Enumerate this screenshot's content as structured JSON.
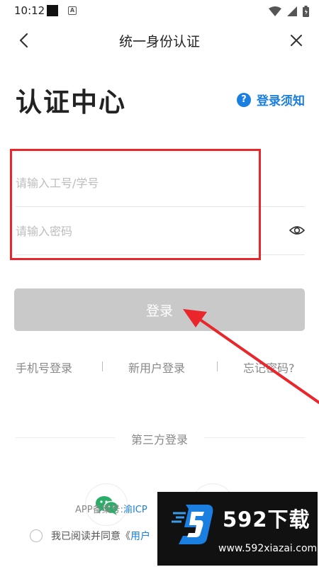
{
  "status_bar": {
    "time": "10:12"
  },
  "nav": {
    "title": "统一身份认证"
  },
  "header": {
    "title": "认证中心",
    "help_label": "登录须知"
  },
  "form": {
    "account_placeholder": "请输入工号/学号",
    "account_value": "",
    "password_placeholder": "请输入密码",
    "password_value": "",
    "login_label": "登录"
  },
  "links": {
    "phone_login": "手机号登录",
    "register": "新用户登录",
    "forgot_password": "忘记密码?"
  },
  "third_party": {
    "label": "第三方登录"
  },
  "footer": {
    "icp_prefix": "APP备案号:",
    "icp_link": "渝ICP",
    "agree_prefix": "我已阅读并同意《",
    "agree_link": "用户"
  },
  "watermark": {
    "name": "592下载",
    "url": "www.592xiazai.com"
  },
  "colors": {
    "accent": "#1a7fe0",
    "annotation": "#e8262b",
    "button_disabled": "#c9c9c9"
  },
  "icons": [
    "back-arrow-icon",
    "close-icon",
    "help-icon",
    "eye-icon",
    "wechat-icon",
    "wifi-icon",
    "signal-icon",
    "battery-icon"
  ]
}
